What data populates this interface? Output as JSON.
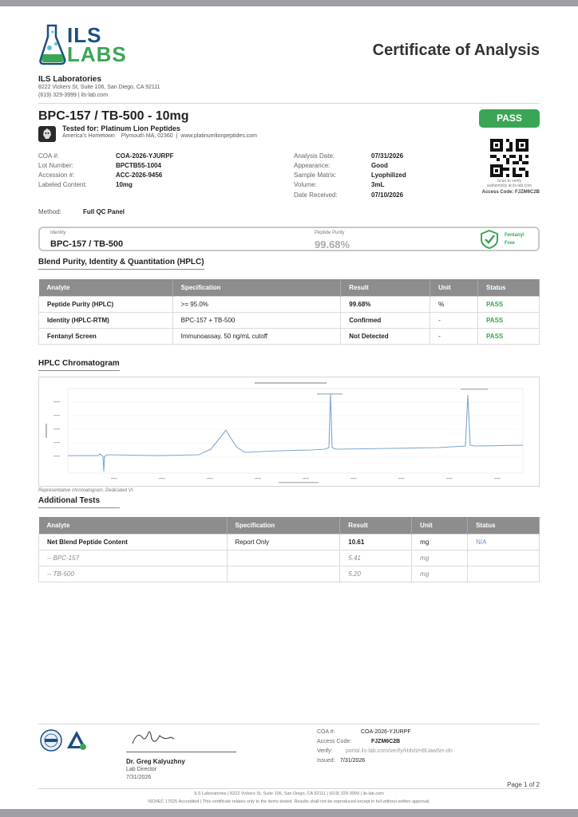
{
  "logo": {
    "line1": "ILS",
    "line2": "LABS"
  },
  "document_title": "Certificate of Analysis",
  "lab": {
    "name": "ILS Laboratories",
    "address": "8222 Vickers St, Suite 106, San Diego, CA 92111",
    "contact": "(619) 329-3999  |  ils-lab.com"
  },
  "product": {
    "title": "BPC-157 / TB-500 - 10mg",
    "overall_result": "PASS",
    "client_name": "Tested for: Platinum Lion Peptides",
    "client_address": "America's Hometown    Plymouth MA, 02360  |  www.platinumlionpeptides.com"
  },
  "details_left": [
    {
      "label": "COA #:",
      "value": "COA-2026-YJURPF"
    },
    {
      "label": "Lot Number:",
      "value": "BPCTB55-1004"
    },
    {
      "label": "Accession #:",
      "value": "ACC-2026-9456"
    },
    {
      "label": "Labeled Content:",
      "value": "10mg"
    }
  ],
  "details_right": [
    {
      "label": "Analysis Date:",
      "value": "07/31/2026"
    },
    {
      "label": "Appearance:",
      "value": "Good"
    },
    {
      "label": "Sample Matrix:",
      "value": "Lyophilized"
    },
    {
      "label": "Volume:",
      "value": "3mL"
    },
    {
      "label": "Date Received:",
      "value": "07/10/2026"
    }
  ],
  "qr": {
    "caption_1": "Scan to verify",
    "caption_2": "authenticity at ils-lab.com",
    "access_code": "Access Code: FJZM6C2B"
  },
  "method": {
    "label": "Method:",
    "value": "Full QC Panel"
  },
  "summary": {
    "identity_label": "Identity",
    "identity_value": "BPC-157 / TB-500",
    "purity_label": "Peptide Purity",
    "purity_value": "99.68%",
    "fentanyl_line1": "Fentanyl",
    "fentanyl_line2": "Free"
  },
  "hplc_section": {
    "title": "Blend Purity, Identity & Quantitation (HPLC)",
    "headers": [
      "Analyte",
      "Specification",
      "Result",
      "Unit",
      "Status"
    ],
    "rows": [
      {
        "analyte": "Peptide Purity (HPLC)",
        "spec": ">= 95.0%",
        "result": "99.68%",
        "unit": "%",
        "status": "PASS"
      },
      {
        "analyte": "Identity (HPLC-RTM)",
        "spec": "BPC-157 + TB-500",
        "result": "Confirmed",
        "unit": "-",
        "status": "PASS"
      },
      {
        "analyte": "Fentanyl Screen",
        "spec": "Immunoassay, 50 ng/mL cutoff",
        "result": "Not Detected",
        "unit": "-",
        "status": "PASS"
      }
    ]
  },
  "chromatogram": {
    "title": "HPLC Chromatogram",
    "caption": "Representative chromatogram. Dedicated VI"
  },
  "additional_section": {
    "title": "Additional Tests",
    "headers": [
      "Analyte",
      "Specification",
      "Result",
      "Unit",
      "Status"
    ],
    "rows": [
      {
        "analyte": "Net Blend Peptide Content",
        "spec": "Report Only",
        "result": "10.61",
        "unit": "mg",
        "status": "N/A"
      },
      {
        "analyte": "-- BPC-157",
        "spec": "",
        "result": "5.41",
        "unit": "mg",
        "status": ""
      },
      {
        "analyte": "-- TB-500",
        "spec": "",
        "result": "5.20",
        "unit": "mg",
        "status": ""
      }
    ]
  },
  "signature": {
    "name": "Dr. Greg Kalyuzhny",
    "role": "Lab Director",
    "date": "7/31/2026"
  },
  "footer_coa": [
    {
      "label": "COA #:",
      "value": "COA-2026-YJURPF"
    },
    {
      "label": "Access Code:",
      "value": "FJZM6C2B"
    },
    {
      "label": "Verify:",
      "value": "portal.ils-lab.com/verify/HdvlzH8Uaw5m-dn"
    },
    {
      "label": "Issued:",
      "value": "7/31/2026"
    }
  ],
  "page_number": "Page 1 of 2",
  "footer": {
    "line1": "ILS Laboratories  |  8222 Vickers St, Suite 106, San Diego, CA 92111  |  (619) 329-3999  |  ils-lab.com",
    "line2": "ISO/IEC 17025 Accredited  |  This certificate relates only to the items tested. Results shall not be reproduced except in full without written approval."
  },
  "colors": {
    "pass_green": "#3aa655",
    "header_gray": "#8d8d8d",
    "brand_blue": "#1c4f82",
    "trace_blue": "#7ea7d6"
  }
}
